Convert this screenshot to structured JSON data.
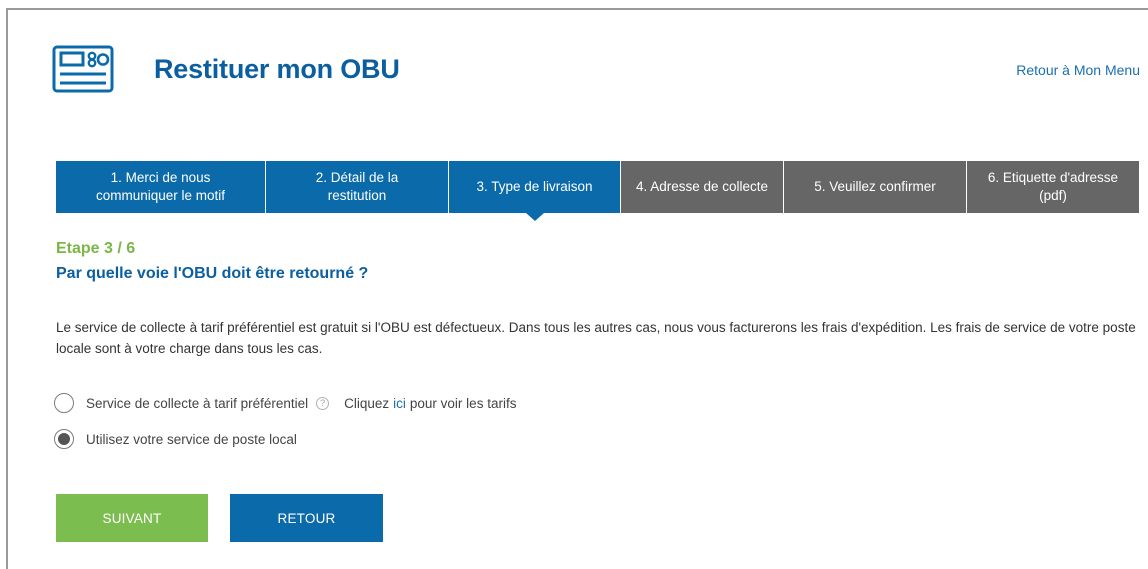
{
  "header": {
    "title": "Restituer mon OBU",
    "back_link": "Retour à Mon Menu",
    "icon": "obu-device-icon"
  },
  "steps": [
    {
      "label": "1. Merci de nous communiquer le motif",
      "state": "done"
    },
    {
      "label": "2. Détail de la restitution",
      "state": "done"
    },
    {
      "label": "3. Type de livraison",
      "state": "active"
    },
    {
      "label": "4. Adresse de collecte",
      "state": "todo"
    },
    {
      "label": "5. Veuillez confirmer",
      "state": "todo"
    },
    {
      "label": "6. Etiquette d'adresse (pdf)",
      "state": "todo"
    }
  ],
  "main": {
    "step_counter": "Etape 3 / 6",
    "heading": "Par quelle voie l'OBU doit être retourné ?",
    "intro": "Le service de collecte à tarif préférentiel est gratuit si l'OBU est défectueux. Dans tous les autres cas, nous vous facturerons les frais d'expédition. Les frais de service de votre poste locale sont à votre charge dans tous les cas.",
    "options": [
      {
        "label": "Service de collecte à tarif préférentiel",
        "help_icon": "question-circle-icon",
        "link_prefix": "Cliquez",
        "link_text": "ici",
        "link_suffix": "pour voir les tarifs",
        "selected": false
      },
      {
        "label": "Utilisez votre service de poste local",
        "selected": true
      }
    ]
  },
  "buttons": {
    "next": "SUIVANT",
    "back": "RETOUR"
  },
  "colors": {
    "brand_blue": "#0b6aa9",
    "title_blue": "#0b5e9f",
    "step_inactive": "#666666",
    "accent_green": "#7cbd4f",
    "step_counter_green": "#7ab648"
  }
}
